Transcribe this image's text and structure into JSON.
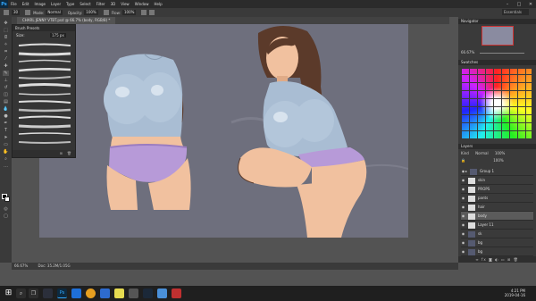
{
  "app": {
    "logo": "Ps"
  },
  "menu": [
    "File",
    "Edit",
    "Image",
    "Layer",
    "Type",
    "Select",
    "Filter",
    "3D",
    "View",
    "Window",
    "Help"
  ],
  "options": {
    "size": "30",
    "mode_label": "Mode:",
    "mode": "Normal",
    "opacity_label": "Opacity:",
    "opacity": "100%",
    "flow_label": "Flow:",
    "flow": "100%",
    "workspace": "Essentials"
  },
  "document": {
    "tab_title": "CHARL JENNY VTBT.psd @ 66.7% (body, RGB/8) *"
  },
  "brush_panel": {
    "title": "Brush Presets",
    "size_label": "Size:",
    "size_value": "175 px"
  },
  "panels": {
    "navigator": "Navigator",
    "zoom": "66.67%",
    "color": "Swatches",
    "layers": "Layers",
    "kind": "Kind",
    "blend": "Normal",
    "opacity": "100%",
    "fill": "100%"
  },
  "layers": [
    {
      "name": "Group 1"
    },
    {
      "name": "skin"
    },
    {
      "name": "PROPS"
    },
    {
      "name": "pants"
    },
    {
      "name": "hair"
    },
    {
      "name": "body"
    },
    {
      "name": "Layer 11"
    },
    {
      "name": "sk"
    },
    {
      "name": "bg"
    },
    {
      "name": "bg"
    }
  ],
  "status": {
    "zoom": "66.67%",
    "doc": "Doc: 35.2M/1.05G"
  },
  "taskbar": {
    "time": "4:21 PM",
    "date": "2019-04-16"
  },
  "colors": {
    "accent": "#31a8ff",
    "canvas": "#6e6f7d",
    "shirt": "#a9bdd3",
    "panties": "#b79ad8",
    "skin": "#f1c19f",
    "hair": "#5b3a2a"
  }
}
